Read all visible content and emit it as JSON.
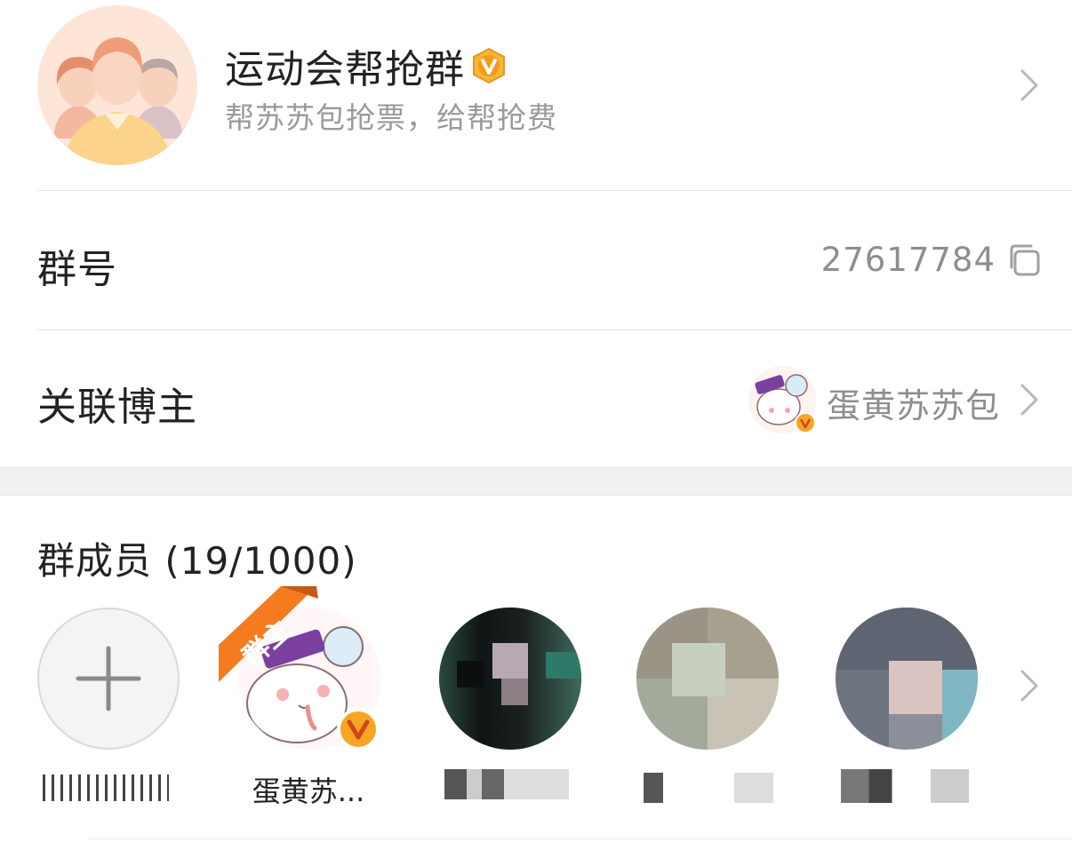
{
  "group": {
    "name": "运动会帮抢群",
    "description": "帮苏苏包抢票，给帮抢费",
    "badge_icon": "vip-v-badge-icon"
  },
  "info": {
    "group_id_label": "群号",
    "group_id_value": "27617784",
    "blogger_label": "关联博主",
    "blogger_name": "蛋黄苏苏包"
  },
  "members": {
    "title": "群成员 (19/1000)",
    "owner_tag": "群主",
    "list": [
      {
        "name": "",
        "type": "add"
      },
      {
        "name": "蛋黄苏...",
        "type": "owner"
      },
      {
        "name": "",
        "type": "member"
      },
      {
        "name": "",
        "type": "member"
      },
      {
        "name": "",
        "type": "member"
      }
    ]
  },
  "colors": {
    "accent_orange": "#f47b20",
    "vip_gold": "#f5a623",
    "text_primary": "#222222",
    "text_secondary": "#8e8e8e"
  }
}
